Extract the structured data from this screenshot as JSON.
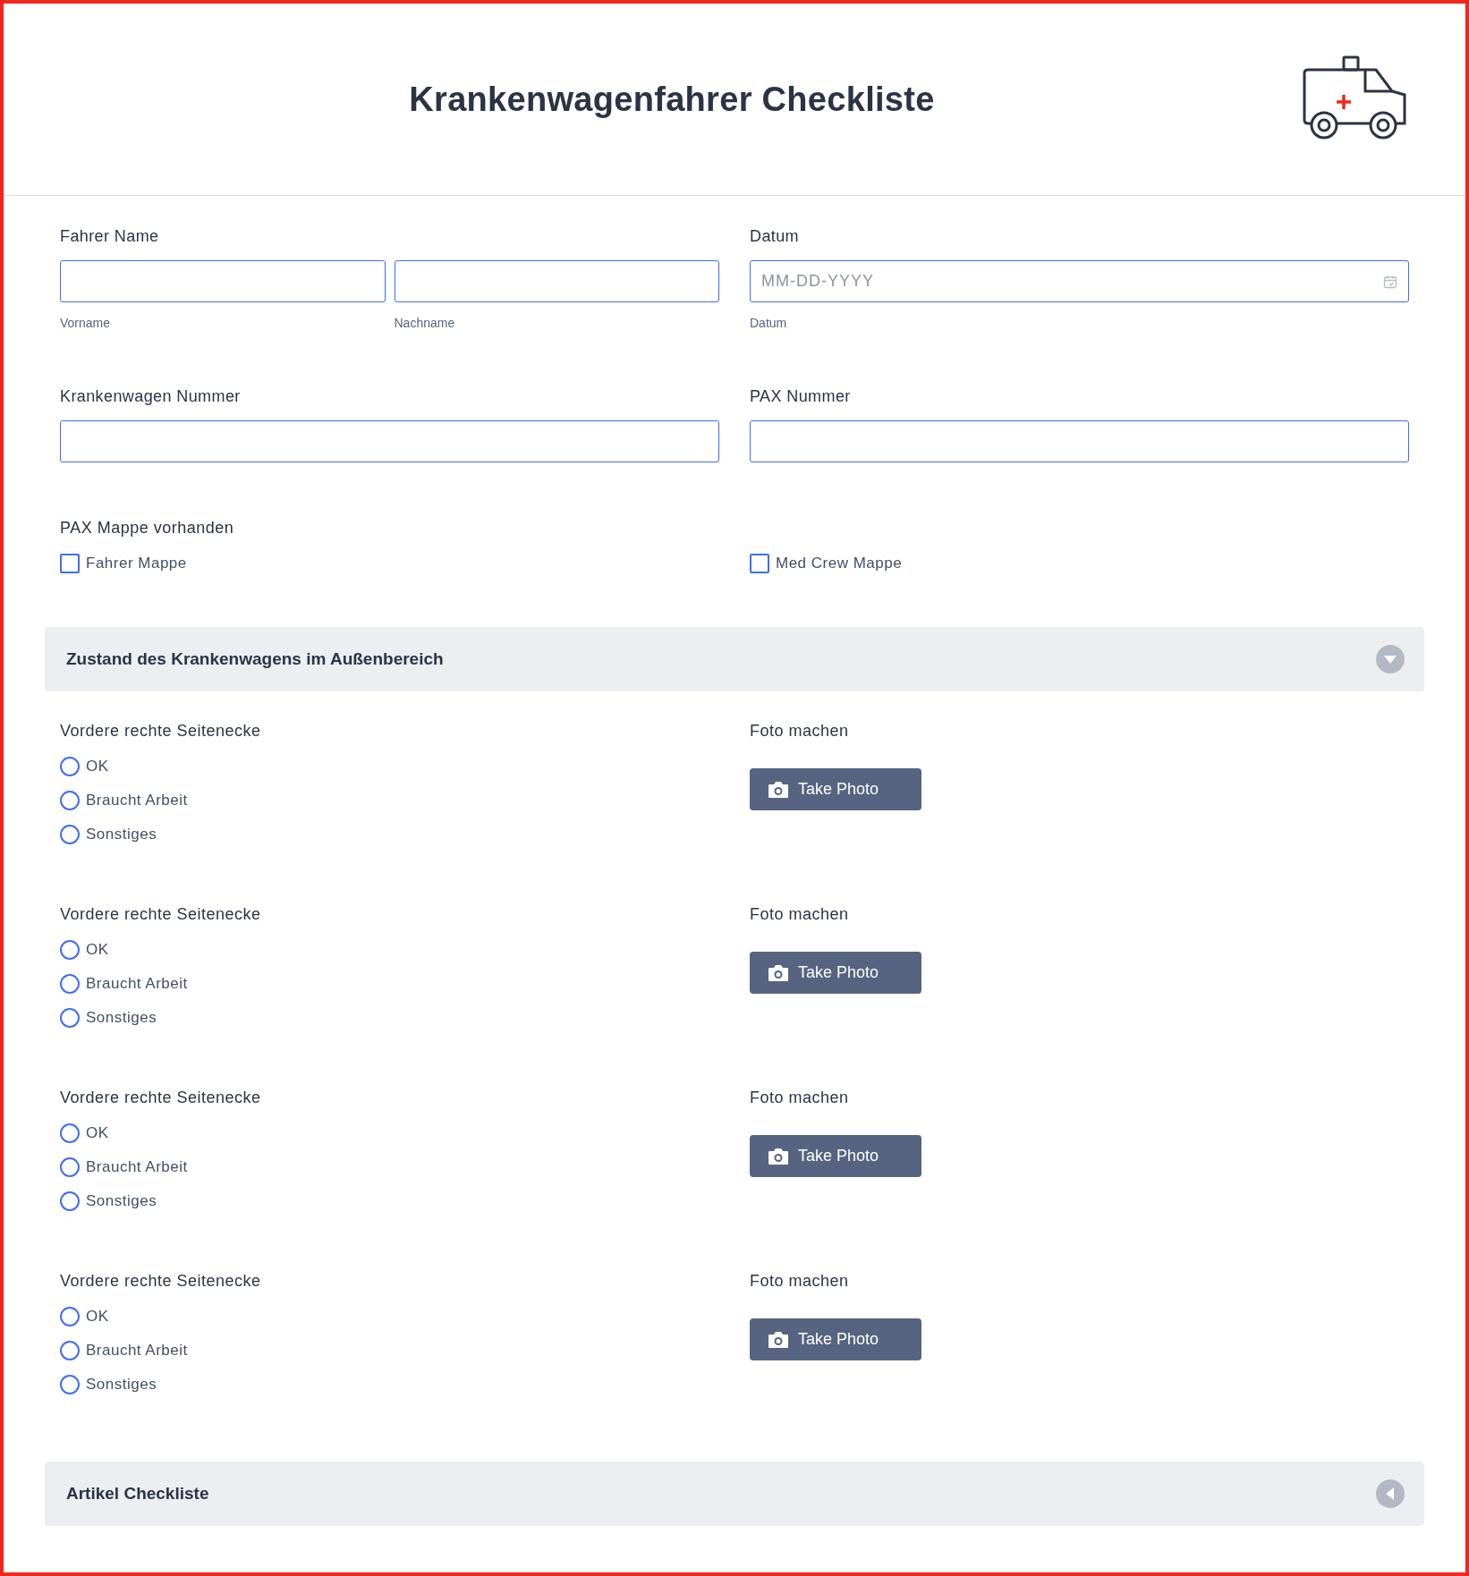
{
  "title": "Krankenwagenfahrer Checkliste",
  "field_rows": [
    [
      {
        "label": "Fahrer Name",
        "inputs": [
          {
            "kind": "text",
            "sublabel": "Vorname"
          },
          {
            "kind": "text",
            "sublabel": "Nachname"
          }
        ]
      },
      {
        "label": "Datum",
        "inputs": [
          {
            "kind": "date",
            "placeholder": "MM-DD-YYYY",
            "sublabel": "Datum"
          }
        ]
      }
    ],
    [
      {
        "label": "Krankenwagen Nummer",
        "inputs": [
          {
            "kind": "text"
          }
        ]
      },
      {
        "label": "PAX Nummer",
        "inputs": [
          {
            "kind": "text"
          }
        ]
      }
    ]
  ],
  "checkbox_group": {
    "label": "PAX Mappe vorhanden",
    "options": [
      {
        "label": "Fahrer Mappe",
        "checked": false
      },
      {
        "label": "Med Crew Mappe",
        "checked": false
      }
    ]
  },
  "sections": [
    {
      "title": "Zustand des Krankenwagens im Außenbereich",
      "expanded": true,
      "questions": [
        {
          "label": "Vordere rechte Seitenecke",
          "options": [
            {
              "label": "OK",
              "selected": false
            },
            {
              "label": "Braucht Arbeit",
              "selected": false
            },
            {
              "label": "Sonstiges",
              "selected": false
            }
          ],
          "photo_label": "Foto machen",
          "photo_button": "Take Photo"
        },
        {
          "label": "Vordere rechte Seitenecke",
          "options": [
            {
              "label": "OK",
              "selected": false
            },
            {
              "label": "Braucht Arbeit",
              "selected": false
            },
            {
              "label": "Sonstiges",
              "selected": false
            }
          ],
          "photo_label": "Foto machen",
          "photo_button": "Take Photo"
        },
        {
          "label": "Vordere rechte Seitenecke",
          "options": [
            {
              "label": "OK",
              "selected": false
            },
            {
              "label": "Braucht Arbeit",
              "selected": false
            },
            {
              "label": "Sonstiges",
              "selected": false
            }
          ],
          "photo_label": "Foto machen",
          "photo_button": "Take Photo"
        },
        {
          "label": "Vordere rechte Seitenecke",
          "options": [
            {
              "label": "OK",
              "selected": false
            },
            {
              "label": "Braucht Arbeit",
              "selected": false
            },
            {
              "label": "Sonstiges",
              "selected": false
            }
          ],
          "photo_label": "Foto machen",
          "photo_button": "Take Photo"
        }
      ]
    },
    {
      "title": "Artikel Checkliste",
      "expanded": false
    }
  ]
}
